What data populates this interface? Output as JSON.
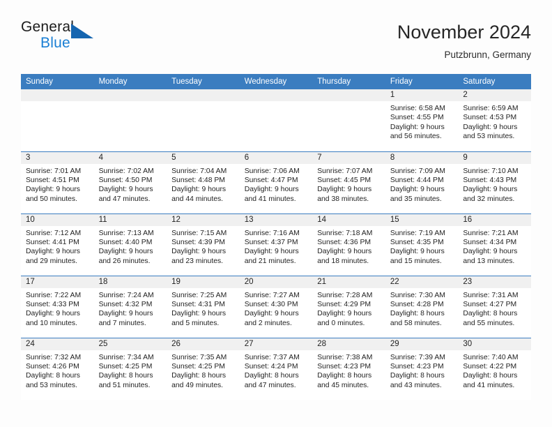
{
  "brand": {
    "general": "General",
    "blue": "Blue",
    "mark": "triangle-logo-icon"
  },
  "header": {
    "title": "November 2024",
    "subtitle": "Putzbrunn, Germany"
  },
  "calendar": {
    "weekday_headers": [
      "Sunday",
      "Monday",
      "Tuesday",
      "Wednesday",
      "Thursday",
      "Friday",
      "Saturday"
    ],
    "labels": {
      "sunrise": "Sunrise:",
      "sunset": "Sunset:",
      "daylight": "Daylight:"
    },
    "colors": {
      "header_blue": "#3b7dc0",
      "daynum_band": "#f0f0f0",
      "brand_blue": "#1a7fd4",
      "mark_blue": "#1565b0"
    },
    "weeks": [
      [
        {
          "day": "",
          "empty": true
        },
        {
          "day": "",
          "empty": true
        },
        {
          "day": "",
          "empty": true
        },
        {
          "day": "",
          "empty": true
        },
        {
          "day": "",
          "empty": true
        },
        {
          "day": "1",
          "sunrise": "Sunrise: 6:58 AM",
          "sunset": "Sunset: 4:55 PM",
          "daylight": "Daylight: 9 hours and 56 minutes."
        },
        {
          "day": "2",
          "sunrise": "Sunrise: 6:59 AM",
          "sunset": "Sunset: 4:53 PM",
          "daylight": "Daylight: 9 hours and 53 minutes."
        }
      ],
      [
        {
          "day": "3",
          "sunrise": "Sunrise: 7:01 AM",
          "sunset": "Sunset: 4:51 PM",
          "daylight": "Daylight: 9 hours and 50 minutes."
        },
        {
          "day": "4",
          "sunrise": "Sunrise: 7:02 AM",
          "sunset": "Sunset: 4:50 PM",
          "daylight": "Daylight: 9 hours and 47 minutes."
        },
        {
          "day": "5",
          "sunrise": "Sunrise: 7:04 AM",
          "sunset": "Sunset: 4:48 PM",
          "daylight": "Daylight: 9 hours and 44 minutes."
        },
        {
          "day": "6",
          "sunrise": "Sunrise: 7:06 AM",
          "sunset": "Sunset: 4:47 PM",
          "daylight": "Daylight: 9 hours and 41 minutes."
        },
        {
          "day": "7",
          "sunrise": "Sunrise: 7:07 AM",
          "sunset": "Sunset: 4:45 PM",
          "daylight": "Daylight: 9 hours and 38 minutes."
        },
        {
          "day": "8",
          "sunrise": "Sunrise: 7:09 AM",
          "sunset": "Sunset: 4:44 PM",
          "daylight": "Daylight: 9 hours and 35 minutes."
        },
        {
          "day": "9",
          "sunrise": "Sunrise: 7:10 AM",
          "sunset": "Sunset: 4:43 PM",
          "daylight": "Daylight: 9 hours and 32 minutes."
        }
      ],
      [
        {
          "day": "10",
          "sunrise": "Sunrise: 7:12 AM",
          "sunset": "Sunset: 4:41 PM",
          "daylight": "Daylight: 9 hours and 29 minutes."
        },
        {
          "day": "11",
          "sunrise": "Sunrise: 7:13 AM",
          "sunset": "Sunset: 4:40 PM",
          "daylight": "Daylight: 9 hours and 26 minutes."
        },
        {
          "day": "12",
          "sunrise": "Sunrise: 7:15 AM",
          "sunset": "Sunset: 4:39 PM",
          "daylight": "Daylight: 9 hours and 23 minutes."
        },
        {
          "day": "13",
          "sunrise": "Sunrise: 7:16 AM",
          "sunset": "Sunset: 4:37 PM",
          "daylight": "Daylight: 9 hours and 21 minutes."
        },
        {
          "day": "14",
          "sunrise": "Sunrise: 7:18 AM",
          "sunset": "Sunset: 4:36 PM",
          "daylight": "Daylight: 9 hours and 18 minutes."
        },
        {
          "day": "15",
          "sunrise": "Sunrise: 7:19 AM",
          "sunset": "Sunset: 4:35 PM",
          "daylight": "Daylight: 9 hours and 15 minutes."
        },
        {
          "day": "16",
          "sunrise": "Sunrise: 7:21 AM",
          "sunset": "Sunset: 4:34 PM",
          "daylight": "Daylight: 9 hours and 13 minutes."
        }
      ],
      [
        {
          "day": "17",
          "sunrise": "Sunrise: 7:22 AM",
          "sunset": "Sunset: 4:33 PM",
          "daylight": "Daylight: 9 hours and 10 minutes."
        },
        {
          "day": "18",
          "sunrise": "Sunrise: 7:24 AM",
          "sunset": "Sunset: 4:32 PM",
          "daylight": "Daylight: 9 hours and 7 minutes."
        },
        {
          "day": "19",
          "sunrise": "Sunrise: 7:25 AM",
          "sunset": "Sunset: 4:31 PM",
          "daylight": "Daylight: 9 hours and 5 minutes."
        },
        {
          "day": "20",
          "sunrise": "Sunrise: 7:27 AM",
          "sunset": "Sunset: 4:30 PM",
          "daylight": "Daylight: 9 hours and 2 minutes."
        },
        {
          "day": "21",
          "sunrise": "Sunrise: 7:28 AM",
          "sunset": "Sunset: 4:29 PM",
          "daylight": "Daylight: 9 hours and 0 minutes."
        },
        {
          "day": "22",
          "sunrise": "Sunrise: 7:30 AM",
          "sunset": "Sunset: 4:28 PM",
          "daylight": "Daylight: 8 hours and 58 minutes."
        },
        {
          "day": "23",
          "sunrise": "Sunrise: 7:31 AM",
          "sunset": "Sunset: 4:27 PM",
          "daylight": "Daylight: 8 hours and 55 minutes."
        }
      ],
      [
        {
          "day": "24",
          "sunrise": "Sunrise: 7:32 AM",
          "sunset": "Sunset: 4:26 PM",
          "daylight": "Daylight: 8 hours and 53 minutes."
        },
        {
          "day": "25",
          "sunrise": "Sunrise: 7:34 AM",
          "sunset": "Sunset: 4:25 PM",
          "daylight": "Daylight: 8 hours and 51 minutes."
        },
        {
          "day": "26",
          "sunrise": "Sunrise: 7:35 AM",
          "sunset": "Sunset: 4:25 PM",
          "daylight": "Daylight: 8 hours and 49 minutes."
        },
        {
          "day": "27",
          "sunrise": "Sunrise: 7:37 AM",
          "sunset": "Sunset: 4:24 PM",
          "daylight": "Daylight: 8 hours and 47 minutes."
        },
        {
          "day": "28",
          "sunrise": "Sunrise: 7:38 AM",
          "sunset": "Sunset: 4:23 PM",
          "daylight": "Daylight: 8 hours and 45 minutes."
        },
        {
          "day": "29",
          "sunrise": "Sunrise: 7:39 AM",
          "sunset": "Sunset: 4:23 PM",
          "daylight": "Daylight: 8 hours and 43 minutes."
        },
        {
          "day": "30",
          "sunrise": "Sunrise: 7:40 AM",
          "sunset": "Sunset: 4:22 PM",
          "daylight": "Daylight: 8 hours and 41 minutes."
        }
      ]
    ]
  }
}
